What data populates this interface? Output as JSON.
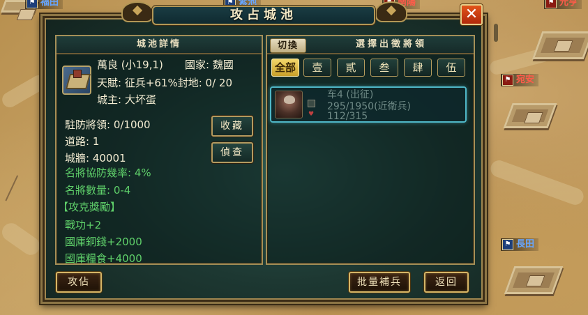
{
  "map": {
    "cities": [
      {
        "name": "福田",
        "color": "blue"
      },
      {
        "name": "紫池",
        "color": "blue"
      },
      {
        "name": "南陽",
        "color": "red"
      },
      {
        "name": "元亨",
        "color": "red"
      },
      {
        "name": "宛安",
        "color": "red"
      },
      {
        "name": "長田",
        "color": "blue"
      }
    ]
  },
  "dialog": {
    "title": "攻占城池",
    "close_label": "✕"
  },
  "city_panel": {
    "header": "城池詳情",
    "name_line": "萬良 (小19,1)",
    "country_line": "國家: 魏國",
    "talent_line": "天賦: 征兵+61%封地: 0/ 20",
    "lord_line": "城主: 大坏蛋",
    "garrison_line": "駐防將領: 0/1000",
    "road_line": "道路: 1",
    "wall_line": "城牆: 40001",
    "defense_rate_line": "名將協防幾率:  4%",
    "general_count_line": "名將數量:  0-4",
    "reward_header": "【攻克獎勵】",
    "reward_1": "戰功+2",
    "reward_2": "國庫銅錢+2000",
    "reward_3": "國庫糧食+4000",
    "collect_label": "收藏",
    "scout_label": "偵查"
  },
  "general_panel": {
    "switch_label": "切換",
    "title": "選擇出徵將領",
    "tabs": [
      "全部",
      "壹",
      "貳",
      "叁",
      "肆",
      "伍"
    ],
    "active_tab": "全部",
    "general": {
      "name": "车4 (出征)",
      "troops": "295/1950(近衛兵)",
      "hp": "112/315"
    }
  },
  "footer": {
    "attack_label": "攻佔",
    "bulk_reinforce_label": "批量補兵",
    "return_label": "返回"
  }
}
